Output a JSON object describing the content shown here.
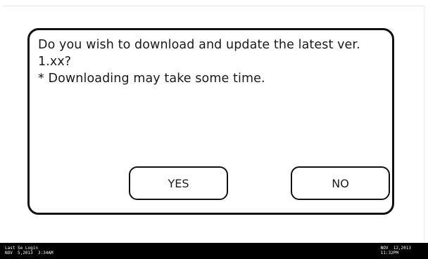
{
  "dialog": {
    "message_line1": "Do you wish to download and update the latest ver.",
    "message_line2": "1.xx?",
    "message_line3": "* Downloading may take some time.",
    "yes_label": "YES",
    "no_label": "NO"
  },
  "status_bar": {
    "last_login_label": "Last Se Login",
    "last_login_date": "NOV  5,2013  3:34AM",
    "current_date": "NOV  12,2013",
    "current_time": "11:32PM"
  },
  "colors": {
    "background": "#ffffff",
    "border": "#111111",
    "status_bar": "#000000",
    "status_text": "#ffffff"
  }
}
